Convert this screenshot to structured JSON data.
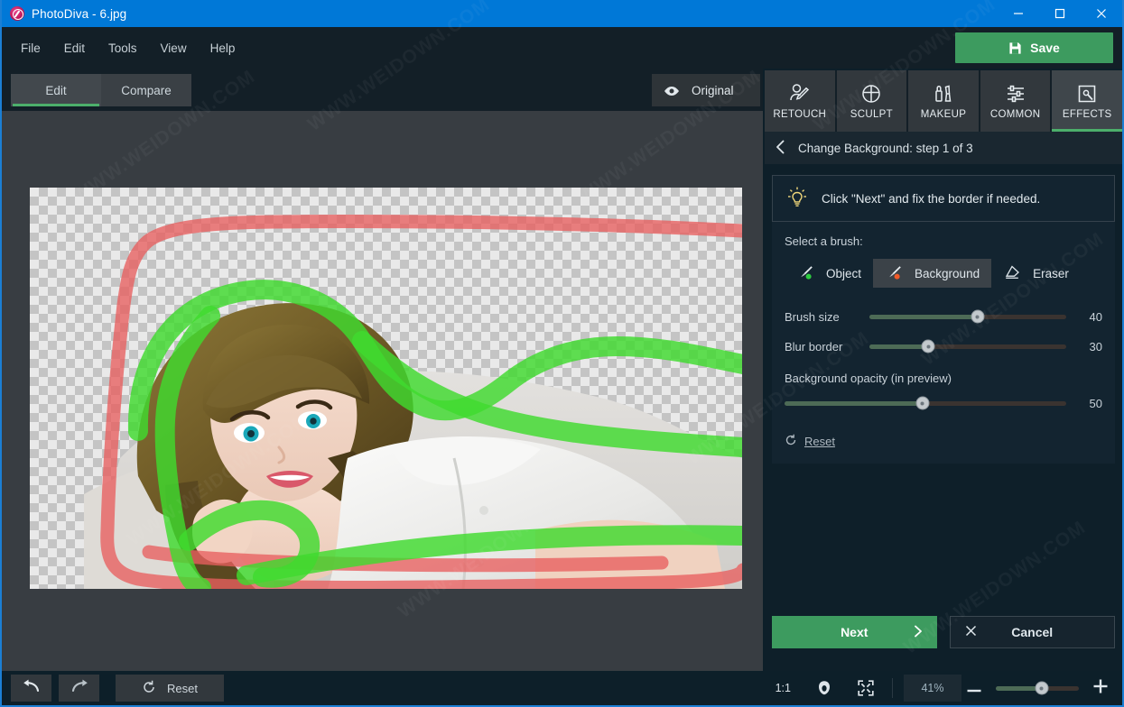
{
  "window": {
    "app_name": "PhotoDiva",
    "title": "PhotoDiva - 6.jpg",
    "icon": "photodiva-logo-icon",
    "minimize": "minimize-icon",
    "maximize": "maximize-icon",
    "close": "close-icon",
    "accent_blue": "#0078d7"
  },
  "menu": {
    "items": [
      {
        "label": "File"
      },
      {
        "label": "Edit"
      },
      {
        "label": "Tools"
      },
      {
        "label": "View"
      },
      {
        "label": "Help"
      }
    ],
    "save_label": "Save",
    "save_icon": "floppy-disk-icon",
    "save_color": "#3d9b5f"
  },
  "view_tabs": {
    "items": [
      {
        "label": "Edit",
        "active": true
      },
      {
        "label": "Compare",
        "active": false
      }
    ],
    "active_underline_color": "#4caf6b"
  },
  "original_toggle": {
    "label": "Original",
    "icon": "eye-icon"
  },
  "modes": {
    "items": [
      {
        "label": "RETOUCH",
        "icon": "retouch-face-icon",
        "active": false
      },
      {
        "label": "SCULPT",
        "icon": "sculpt-circle-icon",
        "active": false
      },
      {
        "label": "MAKEUP",
        "icon": "makeup-lipstick-icon",
        "active": false
      },
      {
        "label": "COMMON",
        "icon": "sliders-icon",
        "active": false
      },
      {
        "label": "EFFECTS",
        "icon": "effects-wand-icon",
        "active": true
      }
    ]
  },
  "panel": {
    "back_icon": "back-chevron-icon",
    "title": "Change Background: step 1 of 3",
    "hint_icon": "lightbulb-icon",
    "hint_text": "Click \"Next\" and fix the border if needed.",
    "brush_section_label": "Select a brush:",
    "brushes": [
      {
        "label": "Object",
        "icon": "brush-object-icon",
        "dot_color": "#2ecc40",
        "selected": false
      },
      {
        "label": "Background",
        "icon": "brush-background-icon",
        "dot_color": "#f05a28",
        "selected": true
      },
      {
        "label": "Eraser",
        "icon": "eraser-icon",
        "dot_color": "",
        "selected": false
      }
    ],
    "sliders": [
      {
        "label": "Brush size",
        "value": 40,
        "percent": 40,
        "inline": true
      },
      {
        "label": "Blur border",
        "value": 30,
        "percent": 30,
        "inline": true
      },
      {
        "label": "Background opacity (in preview)",
        "value": 50,
        "percent": 50,
        "inline": false
      }
    ],
    "reset_label": "Reset",
    "reset_icon": "reset-arrow-icon",
    "next_label": "Next",
    "next_icon": "chevron-right-icon",
    "cancel_label": "Cancel",
    "cancel_icon": "close-x-icon"
  },
  "bottom_bar": {
    "undo_icon": "undo-arrow-icon",
    "redo_icon": "redo-arrow-icon",
    "reset_label": "Reset",
    "reset_icon": "reset-arrow-icon",
    "actual_size_label": "1:1",
    "face_icon": "face-zoom-icon",
    "fit_icon": "fit-to-screen-icon",
    "zoom_value": "41%",
    "zoom_percent": 41,
    "zoom_out_icon": "minus-icon",
    "zoom_in_icon": "plus-icon"
  },
  "canvas": {
    "image_name": "6.jpg",
    "object_stroke_color": "#3fdb2e",
    "background_stroke_color": "#e85f5f",
    "checkerboard_light": "#e9e9e9",
    "checkerboard_dark": "#c4c4c4"
  },
  "watermark": {
    "text": "WWW.WEIDOWN.COM"
  }
}
